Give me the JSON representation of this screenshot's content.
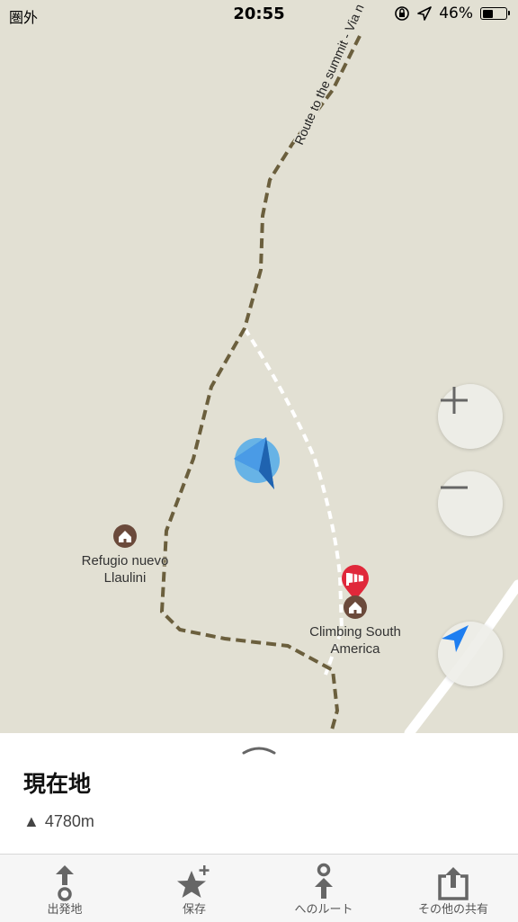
{
  "status_bar": {
    "carrier": "圏外",
    "time": "20:55",
    "battery_percent": "46%",
    "battery_level": 0.46,
    "icons": [
      "rotation-lock-icon",
      "location-arrow-icon",
      "battery-icon"
    ]
  },
  "map": {
    "route_label": "Route to the summit - Via n",
    "pois": [
      {
        "name_line1": "Refugio nuevo",
        "name_line2": "Llaulini",
        "icon": "hut-icon"
      },
      {
        "name_line1": "Climbing South",
        "name_line2": "America",
        "icon": "hut-icon",
        "pin_icon": "windsock-pin-icon"
      }
    ],
    "current_location_icon": "location-arrow-marker-icon",
    "colors": {
      "trail": "#6b5f3d",
      "path": "#ffffff",
      "road": "#ffffff",
      "location": "#3a8fe0",
      "pin": "#e0283a"
    }
  },
  "controls": {
    "zoom_in": "plus-icon",
    "zoom_out": "minus-icon",
    "locate": "navigation-arrow-icon"
  },
  "sheet": {
    "title": "現在地",
    "elevation_symbol": "▲",
    "elevation": "4780m"
  },
  "tabs": [
    {
      "label": "出発地",
      "icon": "start-point-icon"
    },
    {
      "label": "保存",
      "icon": "star-add-icon"
    },
    {
      "label": "へのルート",
      "icon": "route-to-icon"
    },
    {
      "label": "その他の共有",
      "icon": "share-icon"
    }
  ]
}
